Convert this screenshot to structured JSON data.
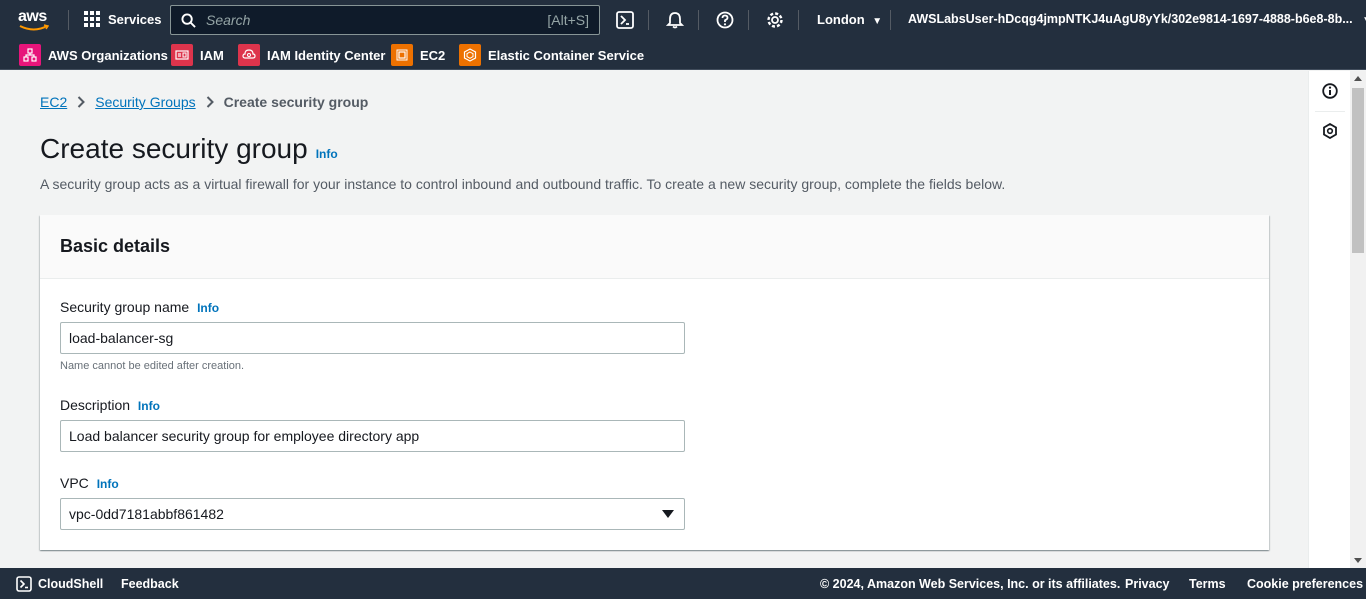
{
  "topnav": {
    "logo_text": "aws",
    "services_label": "Services",
    "search_placeholder": "Search",
    "search_shortcut": "[Alt+S]",
    "region": "London",
    "account": "AWSLabsUser-hDcqg4jmpNTKJ4uAgU8yYk/302e9814-1697-4888-b6e8-8b...",
    "icons": [
      "cloudshell-icon",
      "bell-icon",
      "help-icon",
      "gear-icon"
    ]
  },
  "favorites": [
    {
      "label": "AWS Organizations",
      "color": "#e7157b"
    },
    {
      "label": "IAM",
      "color": "#dd344c"
    },
    {
      "label": "IAM Identity Center",
      "color": "#dd344c"
    },
    {
      "label": "EC2",
      "color": "#ed7100"
    },
    {
      "label": "Elastic Container Service",
      "color": "#ed7100"
    }
  ],
  "breadcrumbs": {
    "ec2": "EC2",
    "security_groups": "Security Groups",
    "current": "Create security group"
  },
  "page": {
    "title": "Create security group",
    "info": "Info",
    "description": "A security group acts as a virtual firewall for your instance to control inbound and outbound traffic. To create a new security group, complete the fields below."
  },
  "basic_details": {
    "heading": "Basic details",
    "name_label": "Security group name",
    "name_info": "Info",
    "name_value": "load-balancer-sg",
    "name_hint": "Name cannot be edited after creation.",
    "description_label": "Description",
    "description_info": "Info",
    "description_value": "Load balancer security group for employee directory app",
    "vpc_label": "VPC",
    "vpc_info": "Info",
    "vpc_value": "vpc-0dd7181abbf861482"
  },
  "footer": {
    "cloudshell": "CloudShell",
    "feedback": "Feedback",
    "copyright": "© 2024, Amazon Web Services, Inc. or its affiliates.",
    "privacy": "Privacy",
    "terms": "Terms",
    "cookies": "Cookie preferences"
  },
  "colors": {
    "nav_bg": "#232f3e",
    "link": "#0073bb",
    "page_bg": "#f2f3f3"
  }
}
